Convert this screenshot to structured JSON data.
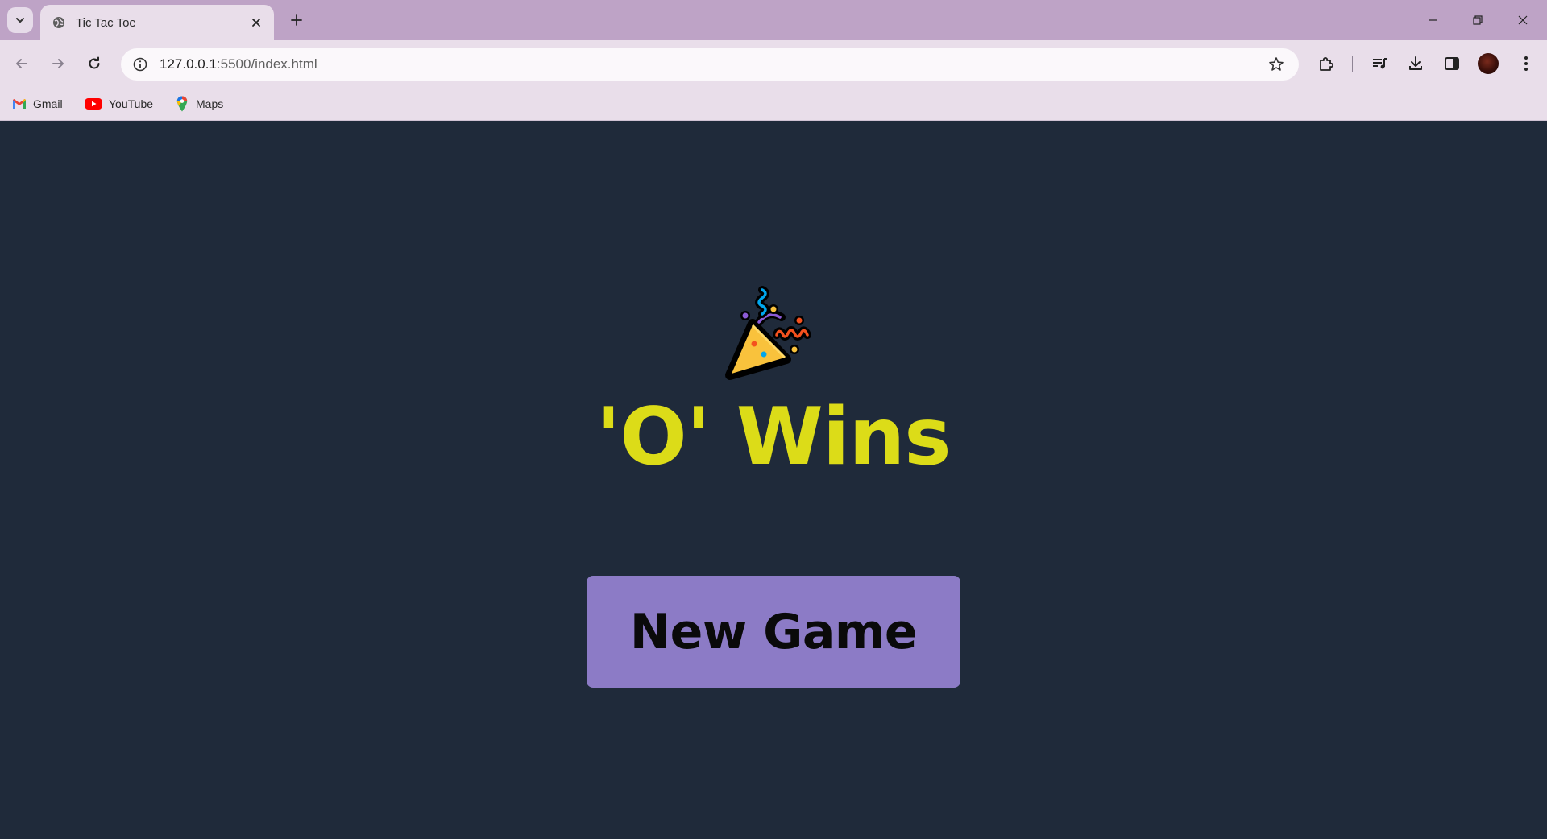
{
  "browser": {
    "tab": {
      "title": "Tic Tac Toe"
    },
    "address": {
      "host": "127.0.0.1",
      "path": ":5500/index.html"
    },
    "bookmarks": [
      {
        "label": "Gmail",
        "icon": "gmail-icon"
      },
      {
        "label": "YouTube",
        "icon": "youtube-icon"
      },
      {
        "label": "Maps",
        "icon": "maps-icon"
      }
    ]
  },
  "game": {
    "result_message": "'O' Wins",
    "celebration_icon": "party-popper-icon",
    "new_game_label": "New Game"
  },
  "colors": {
    "page_background": "#1f2a3a",
    "message_color": "#dcdc18",
    "button_background": "#8c7bc6",
    "browser_frame": "#bea3c6",
    "toolbar": "#e9deea"
  }
}
